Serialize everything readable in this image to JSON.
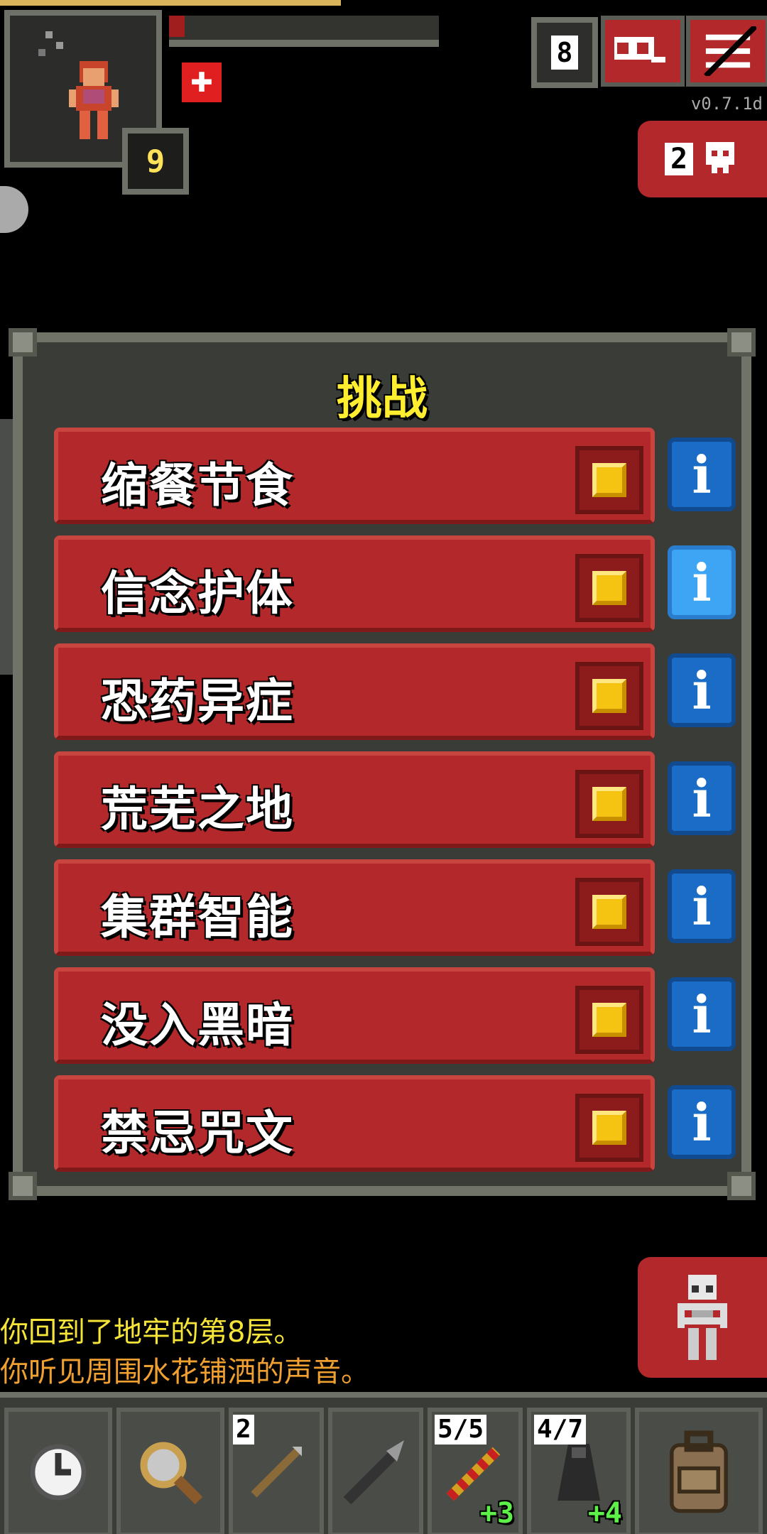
{
  "hud": {
    "level": "9",
    "depth": "8",
    "version": "v0.7.1d",
    "danger_count": "2"
  },
  "challenges": {
    "title": "挑战",
    "items": [
      {
        "label": "缩餐节食",
        "checked": true,
        "info_highlighted": false
      },
      {
        "label": "信念护体",
        "checked": true,
        "info_highlighted": true
      },
      {
        "label": "恐药异症",
        "checked": true,
        "info_highlighted": false
      },
      {
        "label": "荒芜之地",
        "checked": true,
        "info_highlighted": false
      },
      {
        "label": "集群智能",
        "checked": true,
        "info_highlighted": false
      },
      {
        "label": "没入黑暗",
        "checked": true,
        "info_highlighted": false
      },
      {
        "label": "禁忌咒文",
        "checked": true,
        "info_highlighted": false
      }
    ],
    "info_label": "i"
  },
  "log": {
    "line1": "你回到了地牢的第8层。",
    "line2": "你听见周围水花铺洒的声音。"
  },
  "toolbar": {
    "quickslot1_count": "2",
    "quickslot3_charges": "5/5",
    "quickslot3_level": "+3",
    "quickslot4_charges": "4/7",
    "quickslot4_level": "+4"
  },
  "colors": {
    "challenge_button": "#b3292b",
    "info_button": "#1b6cc6",
    "title": "#ffee30",
    "log_line1": "#f6e438",
    "log_line2": "#f0a030"
  }
}
